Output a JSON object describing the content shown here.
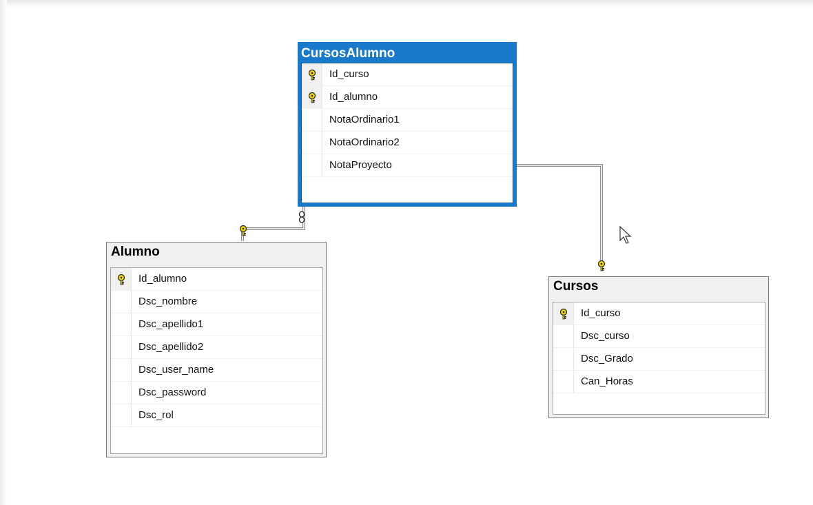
{
  "diagram": {
    "tables": {
      "cursosalumno": {
        "title": "CursosAlumno",
        "selected": true,
        "columns": [
          {
            "name": "Id_curso",
            "key": true
          },
          {
            "name": "Id_alumno",
            "key": true
          },
          {
            "name": "NotaOrdinario1",
            "key": false
          },
          {
            "name": "NotaOrdinario2",
            "key": false
          },
          {
            "name": "NotaProyecto",
            "key": false
          }
        ]
      },
      "alumno": {
        "title": "Alumno",
        "selected": false,
        "columns": [
          {
            "name": "Id_alumno",
            "key": true
          },
          {
            "name": "Dsc_nombre",
            "key": false
          },
          {
            "name": "Dsc_apellido1",
            "key": false
          },
          {
            "name": "Dsc_apellido2",
            "key": false
          },
          {
            "name": "Dsc_user_name",
            "key": false
          },
          {
            "name": "Dsc_password",
            "key": false
          },
          {
            "name": "Dsc_rol",
            "key": false
          }
        ]
      },
      "cursos": {
        "title": "Cursos",
        "selected": false,
        "columns": [
          {
            "name": "Id_curso",
            "key": true
          },
          {
            "name": "Dsc_curso",
            "key": false
          },
          {
            "name": "Dsc_Grado",
            "key": false
          },
          {
            "name": "Can_Horas",
            "key": false
          }
        ]
      }
    },
    "relationships": [
      {
        "from": "alumno",
        "to": "cursosalumno",
        "one_end": "key-icon",
        "many_end": "infinity-icon"
      },
      {
        "from": "cursos",
        "to": "cursosalumno",
        "one_end": "key-icon",
        "many_end": "infinity-icon"
      }
    ],
    "colors": {
      "selection": "#1979ca",
      "header_bg": "#f0f0f0",
      "key_icon": "#f2d400",
      "connector": "#8c8c8c"
    }
  }
}
